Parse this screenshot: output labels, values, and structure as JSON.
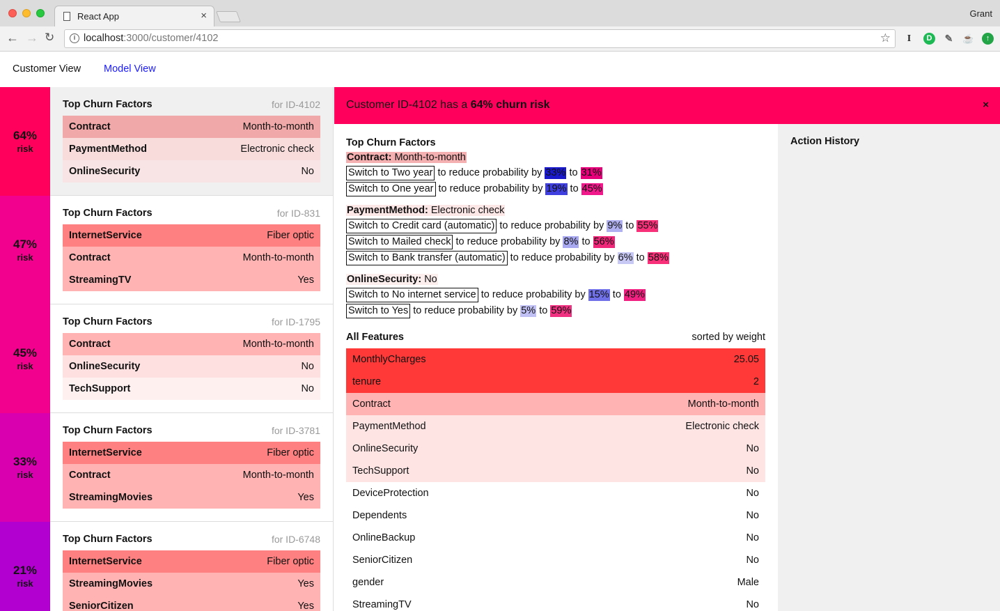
{
  "browser": {
    "tab_title": "React App",
    "tab_close": "×",
    "user": "Grant",
    "url_host": "localhost",
    "url_path": ":3000/customer/4102",
    "ext_icons": [
      "I",
      "D",
      "✎",
      "☕",
      "↑"
    ]
  },
  "nav": {
    "customer_view": "Customer View",
    "model_view": "Model View"
  },
  "colors": {
    "risk_64": "#ff005c",
    "risk_47": "#f2008e",
    "risk_45": "#f2008e",
    "risk_33": "#d900b0",
    "risk_21": "#b200d0",
    "factor_strong": "#ff8080",
    "factor_mid": "#ffb3b3",
    "factor_light": "#ffe0e0"
  },
  "customers": [
    {
      "risk": "64%",
      "risk_label": "risk",
      "heading": "Top Churn Factors",
      "id": "for ID-4102",
      "factors": [
        {
          "name": "Contract",
          "value": "Month-to-month"
        },
        {
          "name": "PaymentMethod",
          "value": "Electronic check"
        },
        {
          "name": "OnlineSecurity",
          "value": "No"
        }
      ]
    },
    {
      "risk": "47%",
      "risk_label": "risk",
      "heading": "Top Churn Factors",
      "id": "for ID-831",
      "factors": [
        {
          "name": "InternetService",
          "value": "Fiber optic"
        },
        {
          "name": "Contract",
          "value": "Month-to-month"
        },
        {
          "name": "StreamingTV",
          "value": "Yes"
        }
      ]
    },
    {
      "risk": "45%",
      "risk_label": "risk",
      "heading": "Top Churn Factors",
      "id": "for ID-1795",
      "factors": [
        {
          "name": "Contract",
          "value": "Month-to-month"
        },
        {
          "name": "OnlineSecurity",
          "value": "No"
        },
        {
          "name": "TechSupport",
          "value": "No"
        }
      ]
    },
    {
      "risk": "33%",
      "risk_label": "risk",
      "heading": "Top Churn Factors",
      "id": "for ID-3781",
      "factors": [
        {
          "name": "InternetService",
          "value": "Fiber optic"
        },
        {
          "name": "Contract",
          "value": "Month-to-month"
        },
        {
          "name": "StreamingMovies",
          "value": "Yes"
        }
      ]
    },
    {
      "risk": "21%",
      "risk_label": "risk",
      "heading": "Top Churn Factors",
      "id": "for ID-6748",
      "factors": [
        {
          "name": "InternetService",
          "value": "Fiber optic"
        },
        {
          "name": "StreamingMovies",
          "value": "Yes"
        },
        {
          "name": "SeniorCitizen",
          "value": "Yes"
        }
      ]
    }
  ],
  "detail": {
    "title_prefix": "Customer ID-4102 has a ",
    "title_bold": "64% churn risk",
    "close": "×",
    "top_factors_title": "Top Churn Factors",
    "groups": [
      {
        "name": "Contract:",
        "value": " Month-to-month",
        "actions": [
          {
            "label": "Switch to Two year",
            "mid": " to reduce probability by ",
            "by": "33%",
            "to_word": " to ",
            "to": "31%"
          },
          {
            "label": "Switch to One year",
            "mid": " to reduce probability by ",
            "by": "19%",
            "to_word": " to ",
            "to": "45%"
          }
        ]
      },
      {
        "name": "PaymentMethod:",
        "value": " Electronic check",
        "actions": [
          {
            "label": "Switch to Credit card (automatic)",
            "mid": " to reduce probability by ",
            "by": "9%",
            "to_word": " to ",
            "to": "55%"
          },
          {
            "label": "Switch to Mailed check",
            "mid": " to reduce probability by ",
            "by": "8%",
            "to_word": " to ",
            "to": "56%"
          },
          {
            "label": "Switch to Bank transfer (automatic)",
            "mid": " to reduce probability by ",
            "by": "6%",
            "to_word": " to ",
            "to": "58%"
          }
        ]
      },
      {
        "name": "OnlineSecurity:",
        "value": " No",
        "actions": [
          {
            "label": "Switch to No internet service",
            "mid": " to reduce probability by ",
            "by": "15%",
            "to_word": " to ",
            "to": "49%"
          },
          {
            "label": "Switch to Yes",
            "mid": " to reduce probability by ",
            "by": "5%",
            "to_word": " to ",
            "to": "59%"
          }
        ]
      }
    ],
    "all_features_title": "All Features",
    "sorted_label": "sorted by weight",
    "features": [
      {
        "name": "MonthlyCharges",
        "value": "25.05"
      },
      {
        "name": "tenure",
        "value": "2"
      },
      {
        "name": "Contract",
        "value": "Month-to-month"
      },
      {
        "name": "PaymentMethod",
        "value": "Electronic check"
      },
      {
        "name": "OnlineSecurity",
        "value": "No"
      },
      {
        "name": "TechSupport",
        "value": "No"
      },
      {
        "name": "DeviceProtection",
        "value": "No"
      },
      {
        "name": "Dependents",
        "value": "No"
      },
      {
        "name": "OnlineBackup",
        "value": "No"
      },
      {
        "name": "SeniorCitizen",
        "value": "No"
      },
      {
        "name": "gender",
        "value": "Male"
      },
      {
        "name": "StreamingTV",
        "value": "No"
      }
    ]
  },
  "history": {
    "title": "Action History"
  }
}
